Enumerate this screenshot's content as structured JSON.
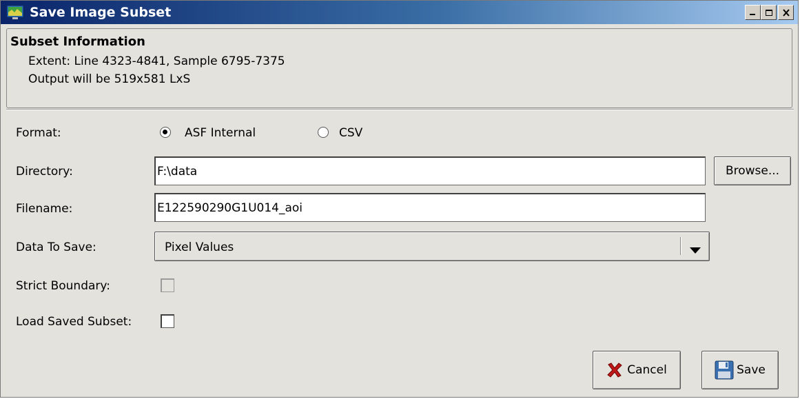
{
  "window": {
    "title": "Save Image Subset",
    "controls": [
      "minimize-icon",
      "maximize-icon",
      "close-icon"
    ]
  },
  "subset_info": {
    "legend": "Subset Information",
    "extent": "Extent: Line 4323-4841, Sample 6795-7375",
    "output": "Output will be 519x581 LxS"
  },
  "format": {
    "label": "Format:",
    "options": [
      {
        "label": "ASF Internal",
        "selected": true
      },
      {
        "label": "CSV",
        "selected": false
      }
    ]
  },
  "directory": {
    "label": "Directory:",
    "value": "F:\\data",
    "browse_label": "Browse..."
  },
  "filename": {
    "label": "Filename:",
    "value": "E122590290G1U014_aoi"
  },
  "data_to_save": {
    "label": "Data To Save:",
    "selected": "Pixel Values"
  },
  "strict_boundary": {
    "label": "Strict Boundary:",
    "checked": false,
    "enabled": false
  },
  "load_saved_subset": {
    "label": "Load Saved Subset:",
    "checked": false,
    "enabled": true
  },
  "buttons": {
    "cancel": "Cancel",
    "save": "Save"
  },
  "colors": {
    "titlebar_start": "#0a246a",
    "titlebar_end": "#a6caf0",
    "dialog_bg": "#e4e2dd"
  }
}
